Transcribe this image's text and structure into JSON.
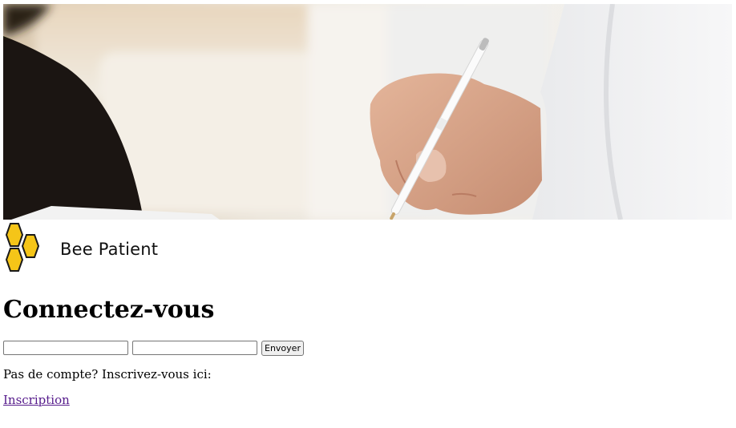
{
  "brand": {
    "name": "Bee Patient",
    "logo_color": "#f5c518"
  },
  "login": {
    "heading": "Connectez-vous",
    "username_value": "",
    "password_value": "",
    "submit_label": "Envoyer"
  },
  "signup": {
    "prompt": "Pas de compte? Inscrivez-vous ici:",
    "link_label": "Inscription"
  },
  "hero": {
    "icon": "doctor-writing-photo"
  }
}
